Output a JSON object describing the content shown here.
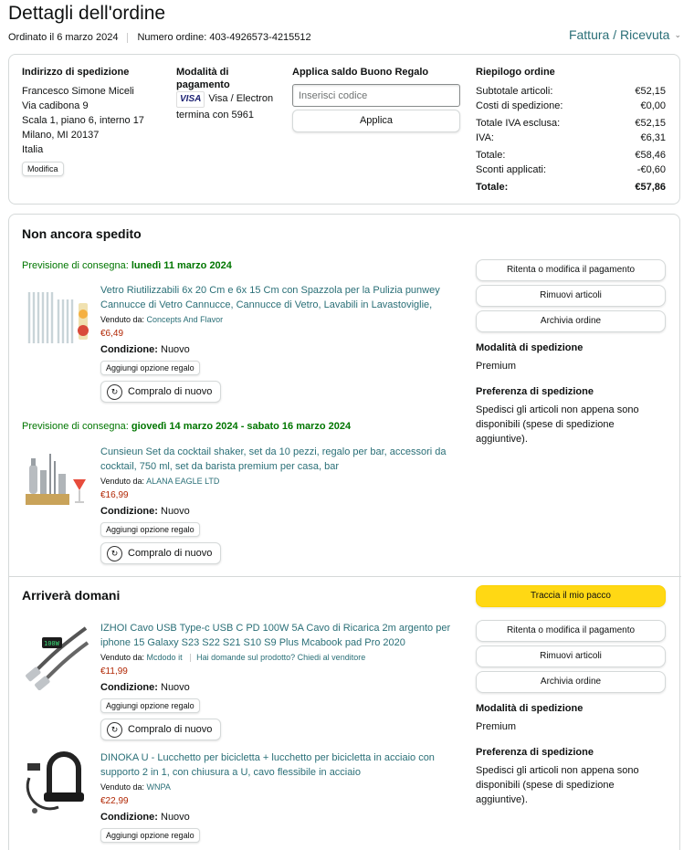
{
  "header": {
    "title": "Dettagli dell'ordine",
    "ordered_on": "Ordinato il 6 marzo 2024",
    "order_number": "Numero ordine: 403-4926573-4215512",
    "invoice_link": "Fattura / Ricevuta"
  },
  "summary": {
    "shipping_address": {
      "heading": "Indirizzo di spedizione",
      "lines": [
        "Francesco Simone Miceli",
        "Via cadibona 9",
        "Scala 1, piano 6, interno 17",
        "Milano, MI 20137",
        "Italia"
      ],
      "edit_label": "Modifica"
    },
    "payment": {
      "heading_1": "Modalità di",
      "heading_2": "pagamento",
      "card_brand": "VISA",
      "card_line_1": "Visa / Electron",
      "card_line_2": "termina con 5961"
    },
    "gift_card": {
      "heading": "Applica saldo Buono Regalo",
      "placeholder": "Inserisci codice",
      "apply_label": "Applica"
    },
    "order_summary": {
      "heading": "Riepilogo ordine",
      "rows": [
        {
          "label": "Subtotale articoli:",
          "value": "€52,15"
        },
        {
          "label": "Costi di spedizione:",
          "value": "€0,00"
        },
        {
          "label": "Totale IVA esclusa:",
          "value": "€52,15"
        },
        {
          "label": "IVA:",
          "value": "€6,31"
        },
        {
          "label": "Totale:",
          "value": "€58,46"
        },
        {
          "label": "Sconti applicati:",
          "value": "-€0,60"
        },
        {
          "label": "Totale:",
          "value": "€57,86"
        }
      ]
    }
  },
  "shipment_1": {
    "title": "Non ancora spedito",
    "groups": [
      {
        "delivery_prefix": "Previsione di consegna: ",
        "delivery_date": "lunedì 11 marzo 2024",
        "item": {
          "title": "Vetro Riutilizzabili 6x 20 Cm e 6x 15 Cm con Spazzola per la Pulizia punwey Cannucce di Vetro Cannucce, Cannucce di Vetro, Lavabili in Lavastoviglie,",
          "seller_prefix": "Venduto da: ",
          "seller": "Concepts And Flavor",
          "price": "€6,49",
          "condition_label": "Condizione:",
          "condition": "Nuovo",
          "gift_label": "Aggiungi opzione regalo",
          "rebuy_label": "Compralo di nuovo"
        }
      },
      {
        "delivery_prefix": "Previsione di consegna: ",
        "delivery_date": "giovedì 14 marzo 2024 - sabato 16 marzo 2024",
        "item": {
          "title": "Cunsieun Set da cocktail shaker, set da 10 pezzi, regalo per bar, accessori da cocktail, 750 ml, set da barista premium per casa, bar",
          "seller_prefix": "Venduto da: ",
          "seller": "ALANA EAGLE LTD",
          "price": "€16,99",
          "condition_label": "Condizione:",
          "condition": "Nuovo",
          "gift_label": "Aggiungi opzione regalo",
          "rebuy_label": "Compralo di nuovo"
        }
      }
    ],
    "actions": [
      "Ritenta o modifica il pagamento",
      "Rimuovi articoli",
      "Archivia ordine"
    ],
    "shipping_mode_heading": "Modalità di spedizione",
    "shipping_mode": "Premium",
    "shipping_pref_heading": "Preferenza di spedizione",
    "shipping_pref_text": "Spedisci gli articoli non appena sono disponibili (spese di spedizione aggiuntive)."
  },
  "shipment_2": {
    "title": "Arriverà domani",
    "track_label": "Traccia il mio pacco",
    "items": [
      {
        "title": "IZHOI Cavo USB Type-c USB C PD 100W 5A Cavo di Ricarica 2m argento per iphone 15 Galaxy S23 S22 S21 S10 S9 Plus Mcabook pad Pro 2020",
        "seller_prefix": "Venduto da: ",
        "seller": "Mcdodo it",
        "question": "Hai domande sul prodotto? Chiedi al venditore",
        "price": "€11,99",
        "condition_label": "Condizione:",
        "condition": "Nuovo",
        "gift_label": "Aggiungi opzione regalo",
        "rebuy_label": "Compralo di nuovo"
      },
      {
        "title": "DINOKA U - Lucchetto per bicicletta + lucchetto per bicicletta in acciaio con supporto 2 in 1, con chiusura a U, cavo flessibile in acciaio",
        "seller_prefix": "Venduto da: ",
        "seller": "WNPA",
        "price": "€22,99",
        "condition_label": "Condizione:",
        "condition": "Nuovo",
        "gift_label": "Aggiungi opzione regalo"
      }
    ],
    "actions": [
      "Ritenta o modifica il pagamento",
      "Rimuovi articoli",
      "Archivia ordine"
    ],
    "shipping_mode_heading": "Modalità di spedizione",
    "shipping_mode": "Premium",
    "shipping_pref_heading": "Preferenza di spedizione",
    "shipping_pref_text": "Spedisci gli articoli non appena sono disponibili (spese di spedizione aggiuntive)."
  },
  "icons": {
    "rebuy": "rebuy-icon",
    "chevron": "chevron-down-icon"
  },
  "colors": {
    "link": "#2a6f77",
    "price": "#b12704",
    "delivery": "#007600",
    "track_button": "#ffd814"
  }
}
